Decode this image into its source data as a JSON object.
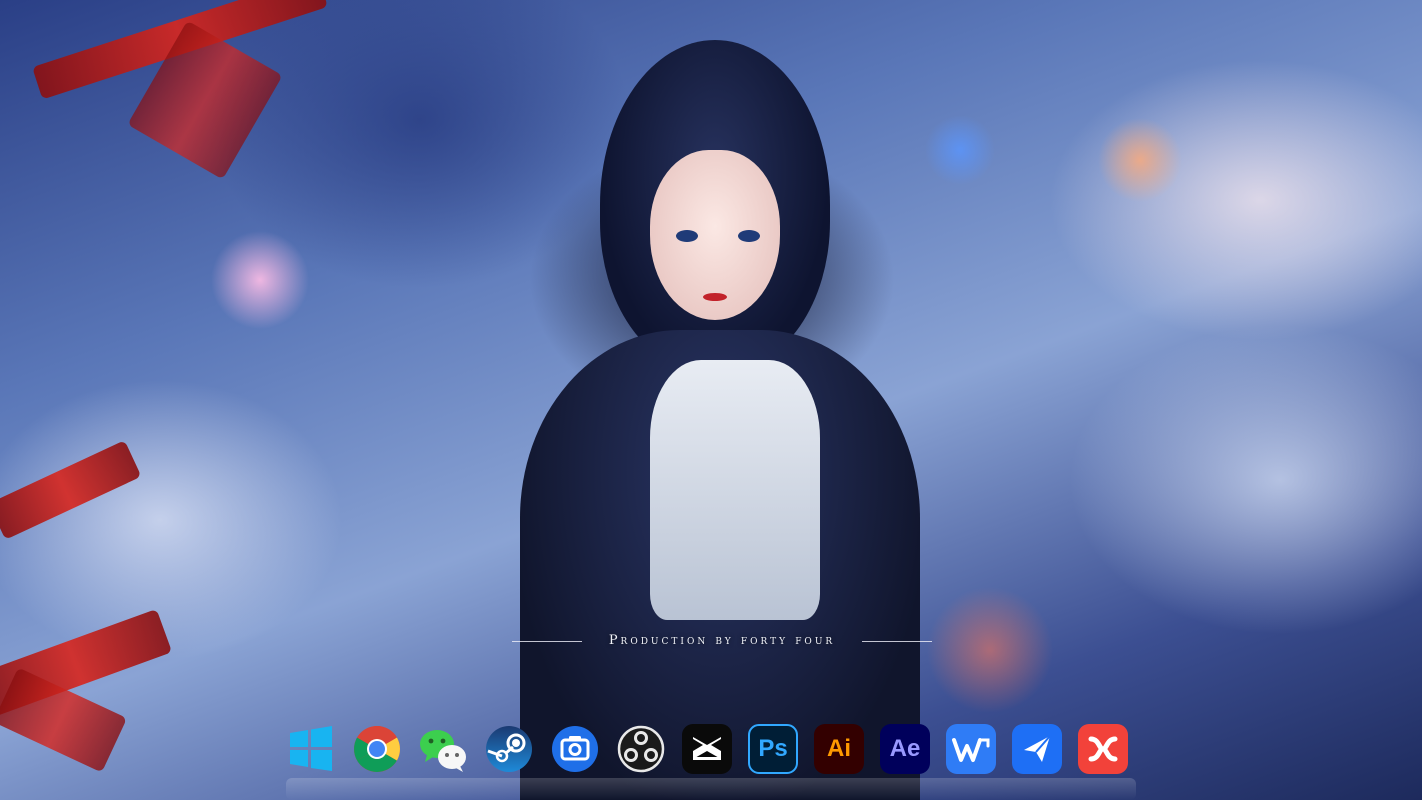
{
  "wallpaper": {
    "watermark_text": "Production by forty four"
  },
  "dock": {
    "items": [
      {
        "name": "Windows Start",
        "icon": "windows-start-icon"
      },
      {
        "name": "Google Chrome",
        "icon": "chrome-icon"
      },
      {
        "name": "WeChat",
        "icon": "wechat-icon"
      },
      {
        "name": "Steam",
        "icon": "steam-icon"
      },
      {
        "name": "Screenshot",
        "icon": "screenshot-icon"
      },
      {
        "name": "OBS Studio",
        "icon": "obs-icon"
      },
      {
        "name": "CapCut",
        "icon": "capcut-icon"
      },
      {
        "name": "Photoshop",
        "icon": "photoshop-icon",
        "label": "Ps"
      },
      {
        "name": "Illustrator",
        "icon": "illustrator-icon",
        "label": "Ai"
      },
      {
        "name": "After Effects",
        "icon": "after-effects-icon",
        "label": "Ae"
      },
      {
        "name": "WPS Office",
        "icon": "wps-icon"
      },
      {
        "name": "Feishu",
        "icon": "feishu-icon"
      },
      {
        "name": "XMind",
        "icon": "xmind-icon"
      }
    ]
  },
  "colors": {
    "photoshop_bg": "#001e36",
    "photoshop_fg": "#31a8ff",
    "illustrator_bg": "#330000",
    "illustrator_fg": "#ff9a00",
    "after_effects_bg": "#00005b",
    "after_effects_fg": "#9999ff",
    "wps": "#2f7cf6",
    "feishu": "#1e6ff5",
    "xmind": "#f2423a"
  }
}
